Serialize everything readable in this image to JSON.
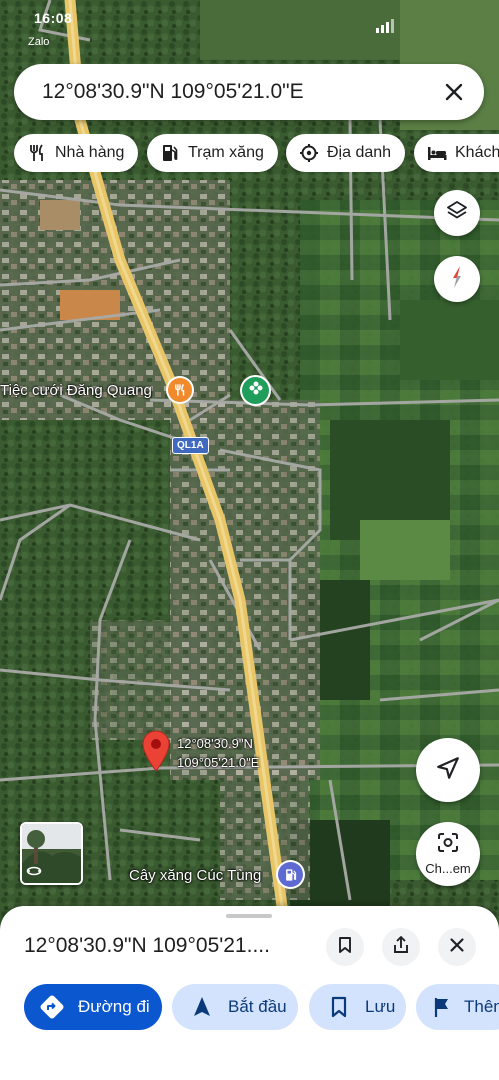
{
  "status_bar": {
    "time": "16:08",
    "app_notification": "Zalo"
  },
  "search": {
    "query": "12°08'30.9\"N 109°05'21.0\"E",
    "close_icon": "close-icon"
  },
  "chips": [
    {
      "label": "Nhà hàng",
      "icon": "restaurant-icon"
    },
    {
      "label": "Trạm xăng",
      "icon": "gas-station-icon"
    },
    {
      "label": "Địa danh",
      "icon": "landmark-icon"
    },
    {
      "label": "Khách sạn",
      "icon": "hotel-icon"
    }
  ],
  "map": {
    "poi_restaurant_label": "Tiệc cưới Đăng Quang",
    "poi_gas_station_label": "Cây xăng Cúc Tùng",
    "road_shield": "QL1A",
    "pin_label_lat": "12°08'30.9\"N",
    "pin_label_lng": "109°05'21.0\"E",
    "layers_icon": "layers-icon",
    "compass_icon": "compass-icon",
    "my_location_icon": "navigation-arrow-icon",
    "lens_label": "Ch...em"
  },
  "sheet": {
    "title": "12°08'30.9\"N 109°05'21....",
    "actions": [
      {
        "label": "Đường đi",
        "icon": "directions-icon"
      },
      {
        "label": "Bắt đầu",
        "icon": "navigation-icon"
      },
      {
        "label": "Lưu",
        "icon": "bookmark-icon"
      },
      {
        "label": "Thêm nhãn",
        "icon": "flag-icon"
      }
    ]
  },
  "colors": {
    "primary_blue": "#0b57d0",
    "secondary_blue": "#d3e3fd",
    "pin_red": "#ea4335",
    "highway_yellow": "#f2d37a"
  }
}
